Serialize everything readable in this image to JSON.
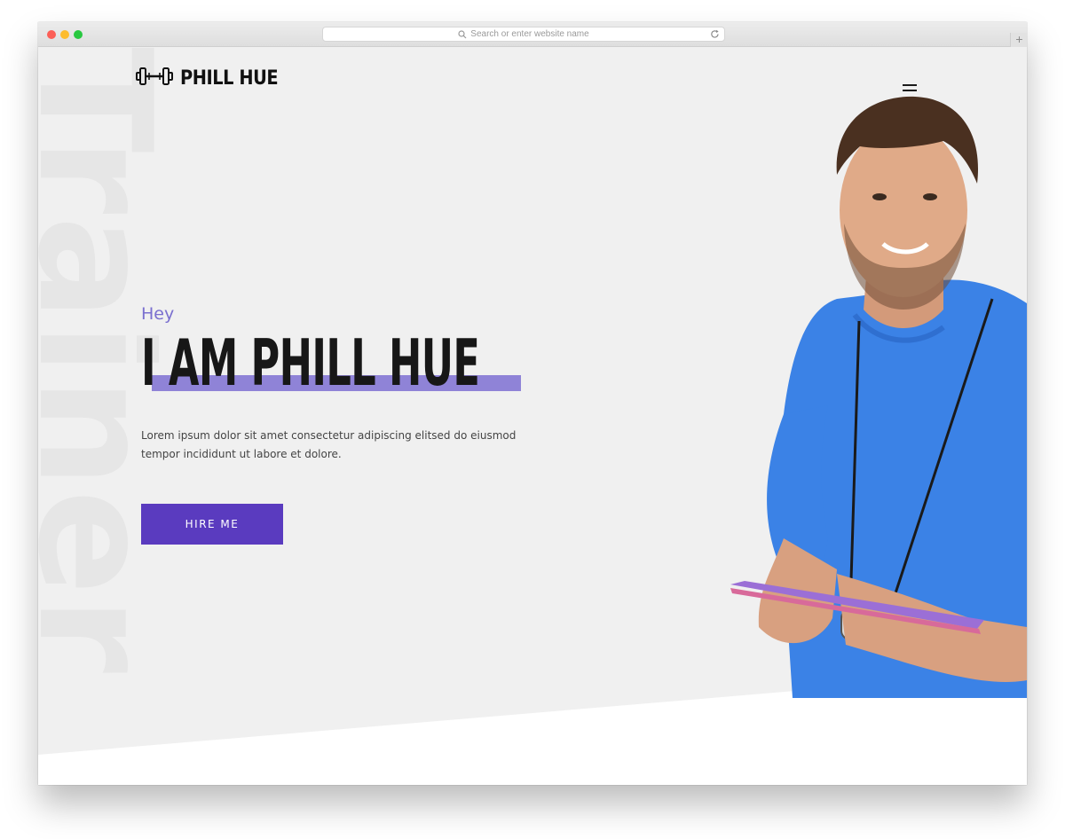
{
  "browser": {
    "address_placeholder": "Search or enter website name",
    "new_tab_label": "+"
  },
  "site": {
    "brand": "PHILL HUE",
    "watermark": "Trainer",
    "menu_icon": "hamburger-menu-icon",
    "logo_icon": "dumbbell-icon"
  },
  "hero": {
    "greeting": "Hey",
    "headline": "I AM PHILL HUE",
    "intro_line1": "Lorem ipsum dolor sit amet consectetur adipiscing elitsed do eiusmod",
    "intro_line2": "tempor incididunt ut labore et dolore.",
    "cta_label": "HIRE ME"
  },
  "colors": {
    "accent": "#5a3bbf",
    "highlight": "#8f83d7",
    "greeting": "#7a6fcf",
    "hero_background": "#f0f0f0",
    "shirt": "#3b82e6"
  }
}
